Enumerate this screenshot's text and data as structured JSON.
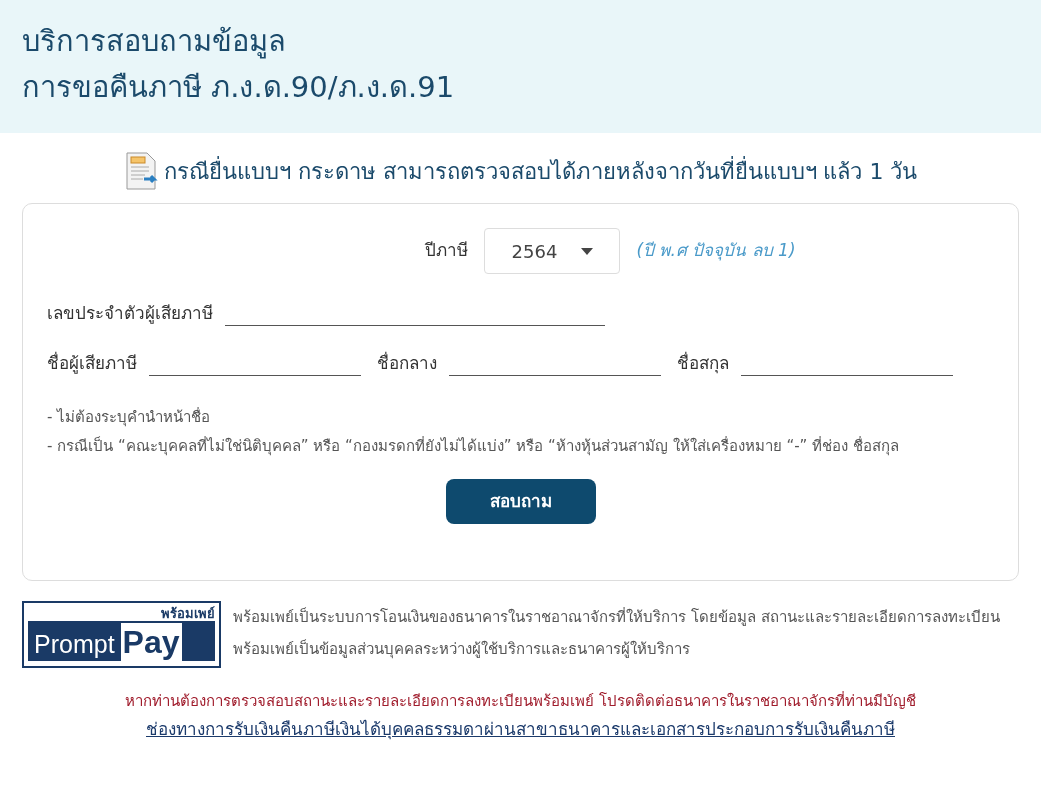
{
  "header": {
    "title_lines": [
      "บริการสอบถามข้อมูล",
      "การขอคืนภาษี ภ.ง.ด.90/ภ.ง.ด.91"
    ]
  },
  "notice": "กรณียื่นแบบฯ กระดาษ สามารถตรวจสอบได้ภายหลังจากวันที่ยื่นแบบฯ แล้ว 1 วัน",
  "form": {
    "tax_year": {
      "label": "ปีภาษี",
      "value": "2564",
      "hint": "(ปี พ.ศ ปัจจุบัน ลบ 1)"
    },
    "taxpayer_id": {
      "label": "เลขประจำตัวผู้เสียภาษี"
    },
    "name_fields": [
      {
        "label": "ชื่อผู้เสียภาษี"
      },
      {
        "label": "ชื่อกลาง"
      },
      {
        "label": "ชื่อสกุล"
      }
    ],
    "notes": [
      "- ไม่ต้องระบุคำนำหน้าชื่อ",
      "- กรณีเป็น “คณะบุคคลที่ไม่ใช่นิติบุคคล” หรือ “กองมรดกที่ยังไม่ได้แบ่ง” หรือ “ห้างหุ้นส่วนสามัญ ให้ใส่เครื่องหมาย “-” ที่ช่อง ชื่อสกุล"
    ],
    "submit": "สอบถาม"
  },
  "promptpay": {
    "logo_thai": "พร้อมเพย์",
    "logo_prompt": "Prompt",
    "logo_pay": "Pay",
    "text": "พร้อมเพย์เป็นระบบการโอนเงินของธนาคารในราชอาณาจักรที่ให้บริการ โดยข้อมูล สถานะและรายละเอียดการลงทะเบียนพร้อมเพย์เป็นข้อมูลส่วนบุคคลระหว่างผู้ใช้บริการและธนาคารผู้ให้บริการ"
  },
  "contact_note": "หากท่านต้องการตรวจสอบสถานะและรายละเอียดการลงทะเบียนพร้อมเพย์ โปรดติดต่อธนาคารในราชอาณาจักรที่ท่านมีบัญชี",
  "link": "ช่องทางการรับเงินคืนภาษีเงินได้บุคคลธรรมดาผ่านสาขาธนาคารและเอกสารประกอบการรับเงินคืนภาษี"
}
